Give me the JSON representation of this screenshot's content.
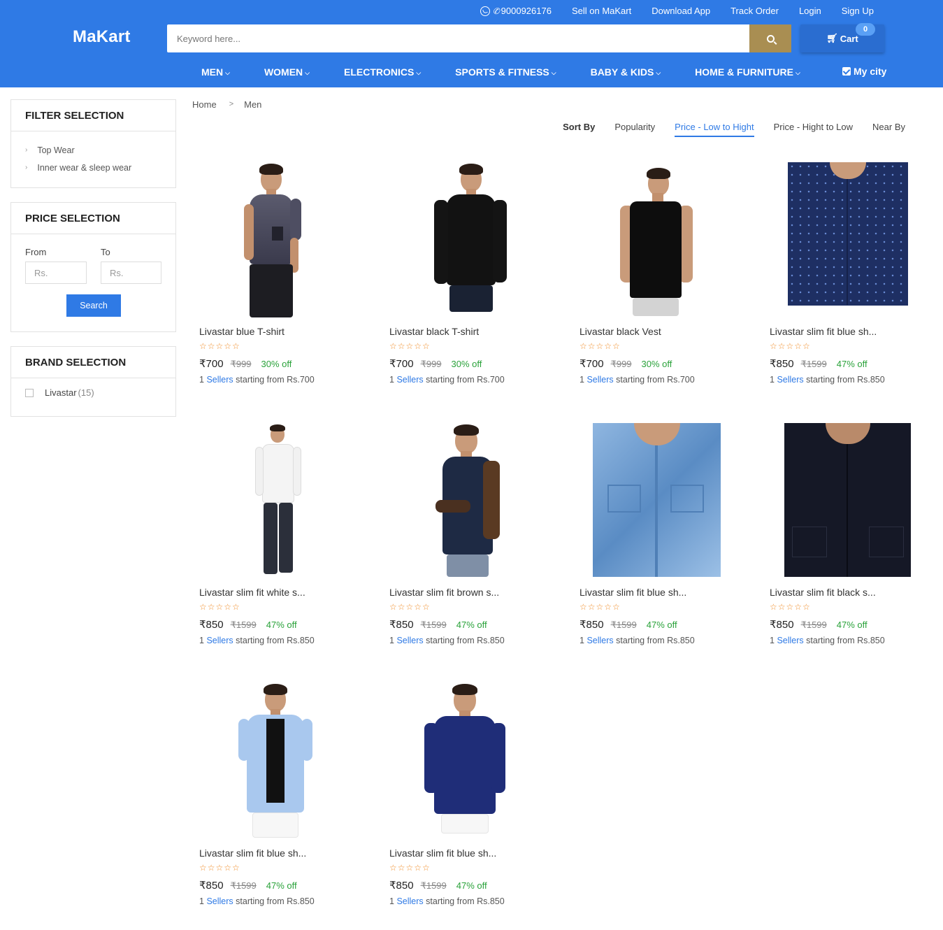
{
  "header": {
    "logo": "MaKart",
    "phone": "9000926176",
    "links": [
      "Sell on MaKart",
      "Download App",
      "Track Order",
      "Login",
      "Sign Up"
    ],
    "search_placeholder": "Keyword here...",
    "cart_label": "Cart",
    "cart_count": "0",
    "my_city": "My city",
    "nav": [
      "MEN",
      "WOMEN",
      "ELECTRONICS",
      "SPORTS & FITNESS",
      "BABY & KIDS",
      "HOME & FURNITURE"
    ],
    "colors": {
      "primary": "#2f7ae5",
      "search_button": "#a98e52"
    }
  },
  "sidebar": {
    "filter_title": "FILTER SELECTION",
    "filters": [
      "Top Wear",
      "Inner wear & sleep wear"
    ],
    "price_title": "PRICE SELECTION",
    "from_label": "From",
    "to_label": "To",
    "from_placeholder": "Rs.",
    "to_placeholder": "Rs.",
    "search_label": "Search",
    "brand_title": "BRAND SELECTION",
    "brand_name": "Livastar",
    "brand_count": "(15)"
  },
  "breadcrumb": {
    "home": "Home",
    "current": "Men"
  },
  "sort": {
    "label": "Sort By",
    "options": [
      "Popularity",
      "Price - Low to Hight",
      "Price - Hight to Low",
      "Near By"
    ],
    "active": "Price - Low to Hight"
  },
  "products": [
    {
      "name": "Livastar blue T-shirt",
      "price": "₹700",
      "mrp": "₹999",
      "off": "30% off",
      "sellers_count": "1",
      "sellers_link": "Sellers",
      "starting": "starting from Rs.700",
      "stars": "☆☆☆☆☆"
    },
    {
      "name": "Livastar black T-shirt",
      "price": "₹700",
      "mrp": "₹999",
      "off": "30% off",
      "sellers_count": "1",
      "sellers_link": "Sellers",
      "starting": "starting from Rs.700",
      "stars": "☆☆☆☆☆"
    },
    {
      "name": "Livastar black Vest",
      "price": "₹700",
      "mrp": "₹999",
      "off": "30% off",
      "sellers_count": "1",
      "sellers_link": "Sellers",
      "starting": "starting from Rs.700",
      "stars": "☆☆☆☆☆"
    },
    {
      "name": "Livastar slim fit blue sh...",
      "price": "₹850",
      "mrp": "₹1599",
      "off": "47% off",
      "sellers_count": "1",
      "sellers_link": "Sellers",
      "starting": "starting from Rs.850",
      "stars": "☆☆☆☆☆"
    },
    {
      "name": "Livastar slim fit white s...",
      "price": "₹850",
      "mrp": "₹1599",
      "off": "47% off",
      "sellers_count": "1",
      "sellers_link": "Sellers",
      "starting": "starting from Rs.850",
      "stars": "☆☆☆☆☆"
    },
    {
      "name": "Livastar slim fit brown s...",
      "price": "₹850",
      "mrp": "₹1599",
      "off": "47% off",
      "sellers_count": "1",
      "sellers_link": "Sellers",
      "starting": "starting from Rs.850",
      "stars": "☆☆☆☆☆"
    },
    {
      "name": "Livastar slim fit blue sh...",
      "price": "₹850",
      "mrp": "₹1599",
      "off": "47% off",
      "sellers_count": "1",
      "sellers_link": "Sellers",
      "starting": "starting from Rs.850",
      "stars": "☆☆☆☆☆"
    },
    {
      "name": "Livastar slim fit black s...",
      "price": "₹850",
      "mrp": "₹1599",
      "off": "47% off",
      "sellers_count": "1",
      "sellers_link": "Sellers",
      "starting": "starting from Rs.850",
      "stars": "☆☆☆☆☆"
    },
    {
      "name": "Livastar slim fit blue sh...",
      "price": "₹850",
      "mrp": "₹1599",
      "off": "47% off",
      "sellers_count": "1",
      "sellers_link": "Sellers",
      "starting": "starting from Rs.850",
      "stars": "☆☆☆☆☆"
    },
    {
      "name": "Livastar slim fit blue sh...",
      "price": "₹850",
      "mrp": "₹1599",
      "off": "47% off",
      "sellers_count": "1",
      "sellers_link": "Sellers",
      "starting": "starting from Rs.850",
      "stars": "☆☆☆☆☆"
    }
  ]
}
